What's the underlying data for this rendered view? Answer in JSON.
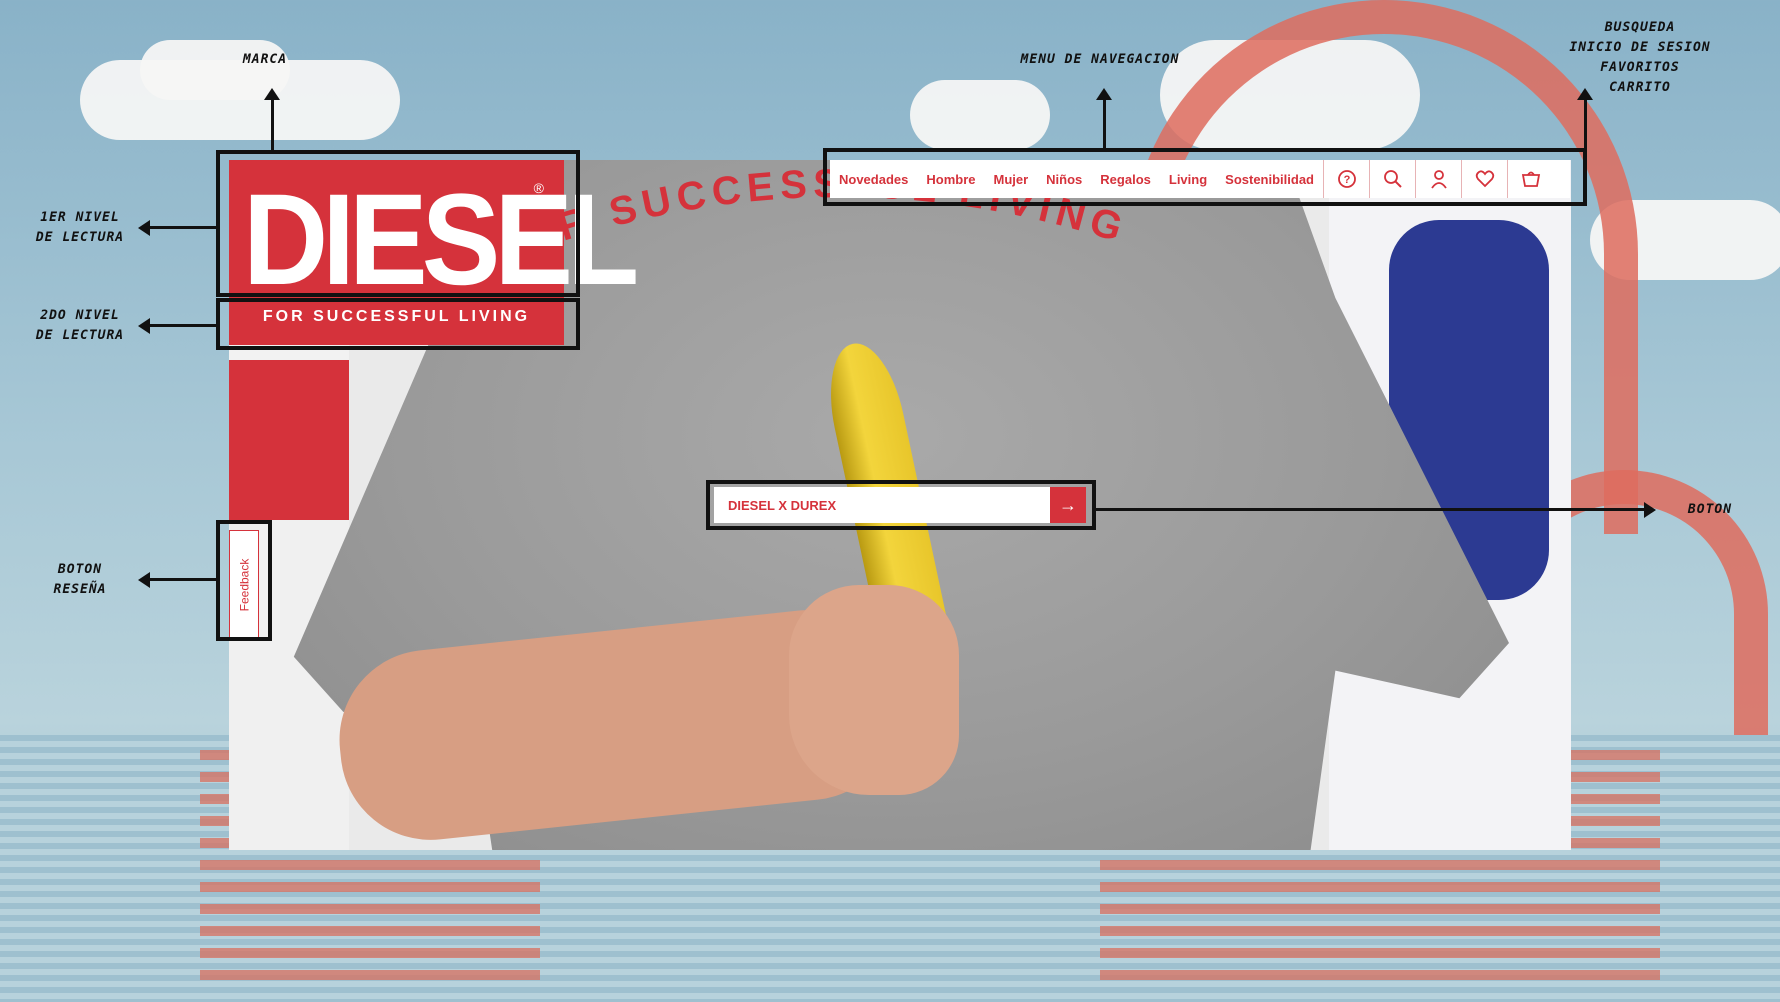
{
  "annotations": {
    "marca": "MARCA",
    "menu": "MENU DE NAVEGACION",
    "utilities": [
      "BUSQUEDA",
      "INICIO DE SESION",
      "FAVORITOS",
      "CARRITO"
    ],
    "nivel1": [
      "1ER NIVEL",
      "DE LECTURA"
    ],
    "nivel2": [
      "2DO NIVEL",
      "DE LECTURA"
    ],
    "boton": "BOTON",
    "boton_resena": [
      "BOTON",
      "RESEÑA"
    ]
  },
  "brand": {
    "name": "DIESEL",
    "registered": "®",
    "tagline": "FOR SUCCESSFUL LIVING",
    "color": "#d5323b"
  },
  "nav": {
    "items": [
      "Novedades",
      "Hombre",
      "Mujer",
      "Niños",
      "Regalos",
      "Living",
      "Sostenibilidad"
    ],
    "icons": [
      "help-icon",
      "search-icon",
      "user-icon",
      "heart-icon",
      "cart-icon"
    ]
  },
  "hero": {
    "shirt_text": "FOR SUCCESSFUL LIVING",
    "cta_label": "DIESEL X DUREX",
    "cta_arrow": "→"
  },
  "feedback": {
    "label": "Feedback"
  }
}
